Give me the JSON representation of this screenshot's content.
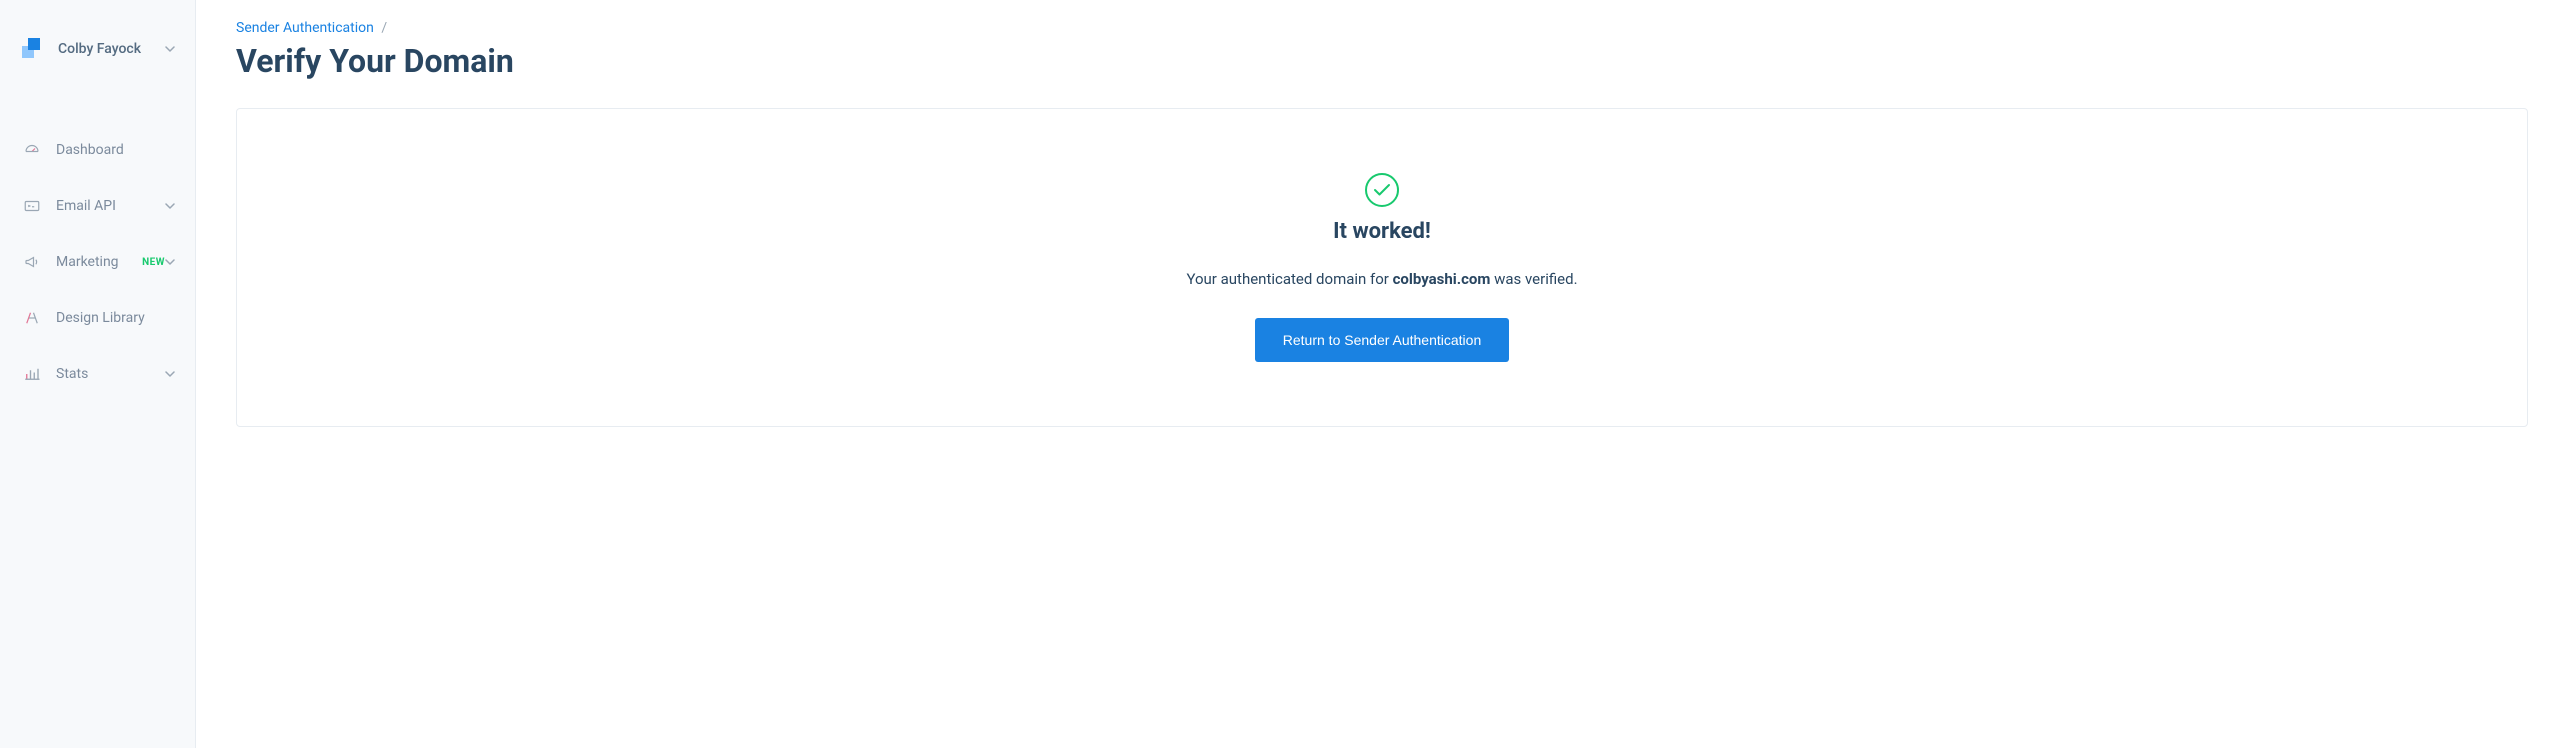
{
  "user": {
    "name": "Colby Fayock"
  },
  "sidebar": {
    "items": [
      {
        "label": "Dashboard",
        "icon": "dashboard",
        "expandable": false,
        "badge": ""
      },
      {
        "label": "Email API",
        "icon": "email-api",
        "expandable": true,
        "badge": ""
      },
      {
        "label": "Marketing",
        "icon": "marketing",
        "expandable": true,
        "badge": "NEW"
      },
      {
        "label": "Design Library",
        "icon": "design-library",
        "expandable": false,
        "badge": ""
      },
      {
        "label": "Stats",
        "icon": "stats",
        "expandable": true,
        "badge": ""
      }
    ]
  },
  "breadcrumb": {
    "parent": "Sender Authentication",
    "separator": "/"
  },
  "page": {
    "title": "Verify Your Domain"
  },
  "card": {
    "heading": "It worked!",
    "message_prefix": "Your authenticated domain for ",
    "domain": "colbyashi.com",
    "message_suffix": " was verified.",
    "button_label": "Return to Sender Authentication"
  }
}
